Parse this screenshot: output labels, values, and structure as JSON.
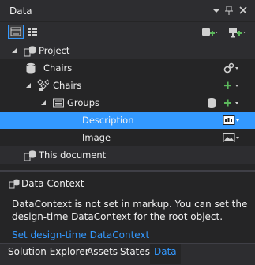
{
  "window": {
    "title": "Data"
  },
  "tree": {
    "rows": [
      {
        "label": "Project"
      },
      {
        "label": "Chairs"
      },
      {
        "label": "Chairs"
      },
      {
        "label": "Groups"
      },
      {
        "label": "Description"
      },
      {
        "label": "Image"
      },
      {
        "label": "This document"
      }
    ]
  },
  "data_context": {
    "title": "Data Context",
    "message_line1": "DataContext is not set in markup. You can set the",
    "message_line2": "design-time DataContext for the root object.",
    "link": "Set design-time DataContext"
  },
  "tabs": [
    {
      "label": "Solution Explorer",
      "active": false
    },
    {
      "label": "Assets",
      "active": false
    },
    {
      "label": "States",
      "active": false
    },
    {
      "label": "Data",
      "active": true
    }
  ],
  "colors": {
    "accent": "#3399ff",
    "add_green": "#5cb85c",
    "panel_bg": "#252526",
    "chrome_bg": "#2d2d30"
  },
  "icons": {
    "title_dropdown": "chevron-down-icon",
    "pin": "pin-icon",
    "close": "close-icon",
    "list_view": "list-view-icon",
    "details_view": "details-view-icon",
    "create_sample_data": "database-add-icon",
    "create_data_source": "data-source-add-icon",
    "project": "project-data-icon",
    "sample_collection": "database-icon",
    "collection": "collection-icon",
    "groups": "array-icon",
    "string_type": "text-abc-icon",
    "image_type": "image-icon",
    "document": "document-data-icon",
    "add": "plus-icon",
    "settings": "gears-icon"
  }
}
